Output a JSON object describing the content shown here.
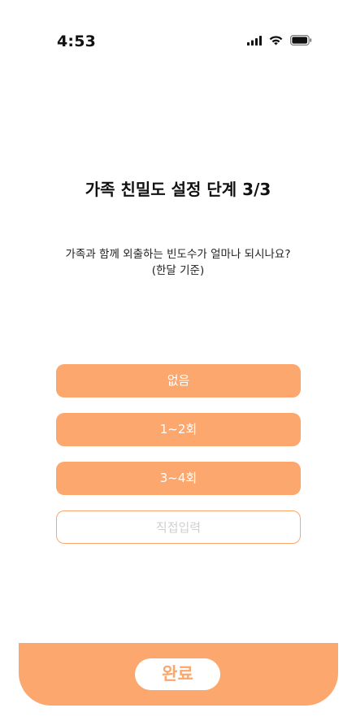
{
  "status_bar": {
    "time": "4:53",
    "icons": [
      "cellular-signal-icon",
      "wifi-icon",
      "battery-icon"
    ]
  },
  "header": {
    "title": "가족 친밀도 설정 단계 3/3"
  },
  "question": {
    "line1": "가족과 함께 외출하는 빈도수가 얼마나 되시나요?",
    "line2": "(한달 기준)"
  },
  "options": [
    {
      "label": "없음"
    },
    {
      "label": "1~2회"
    },
    {
      "label": "3~4회"
    }
  ],
  "direct_input": {
    "placeholder": "직접입력",
    "value": ""
  },
  "footer": {
    "done_label": "완료"
  },
  "colors": {
    "accent": "#FBA76E",
    "background": "#FFFFFF",
    "placeholder": "#CFCFCF"
  }
}
